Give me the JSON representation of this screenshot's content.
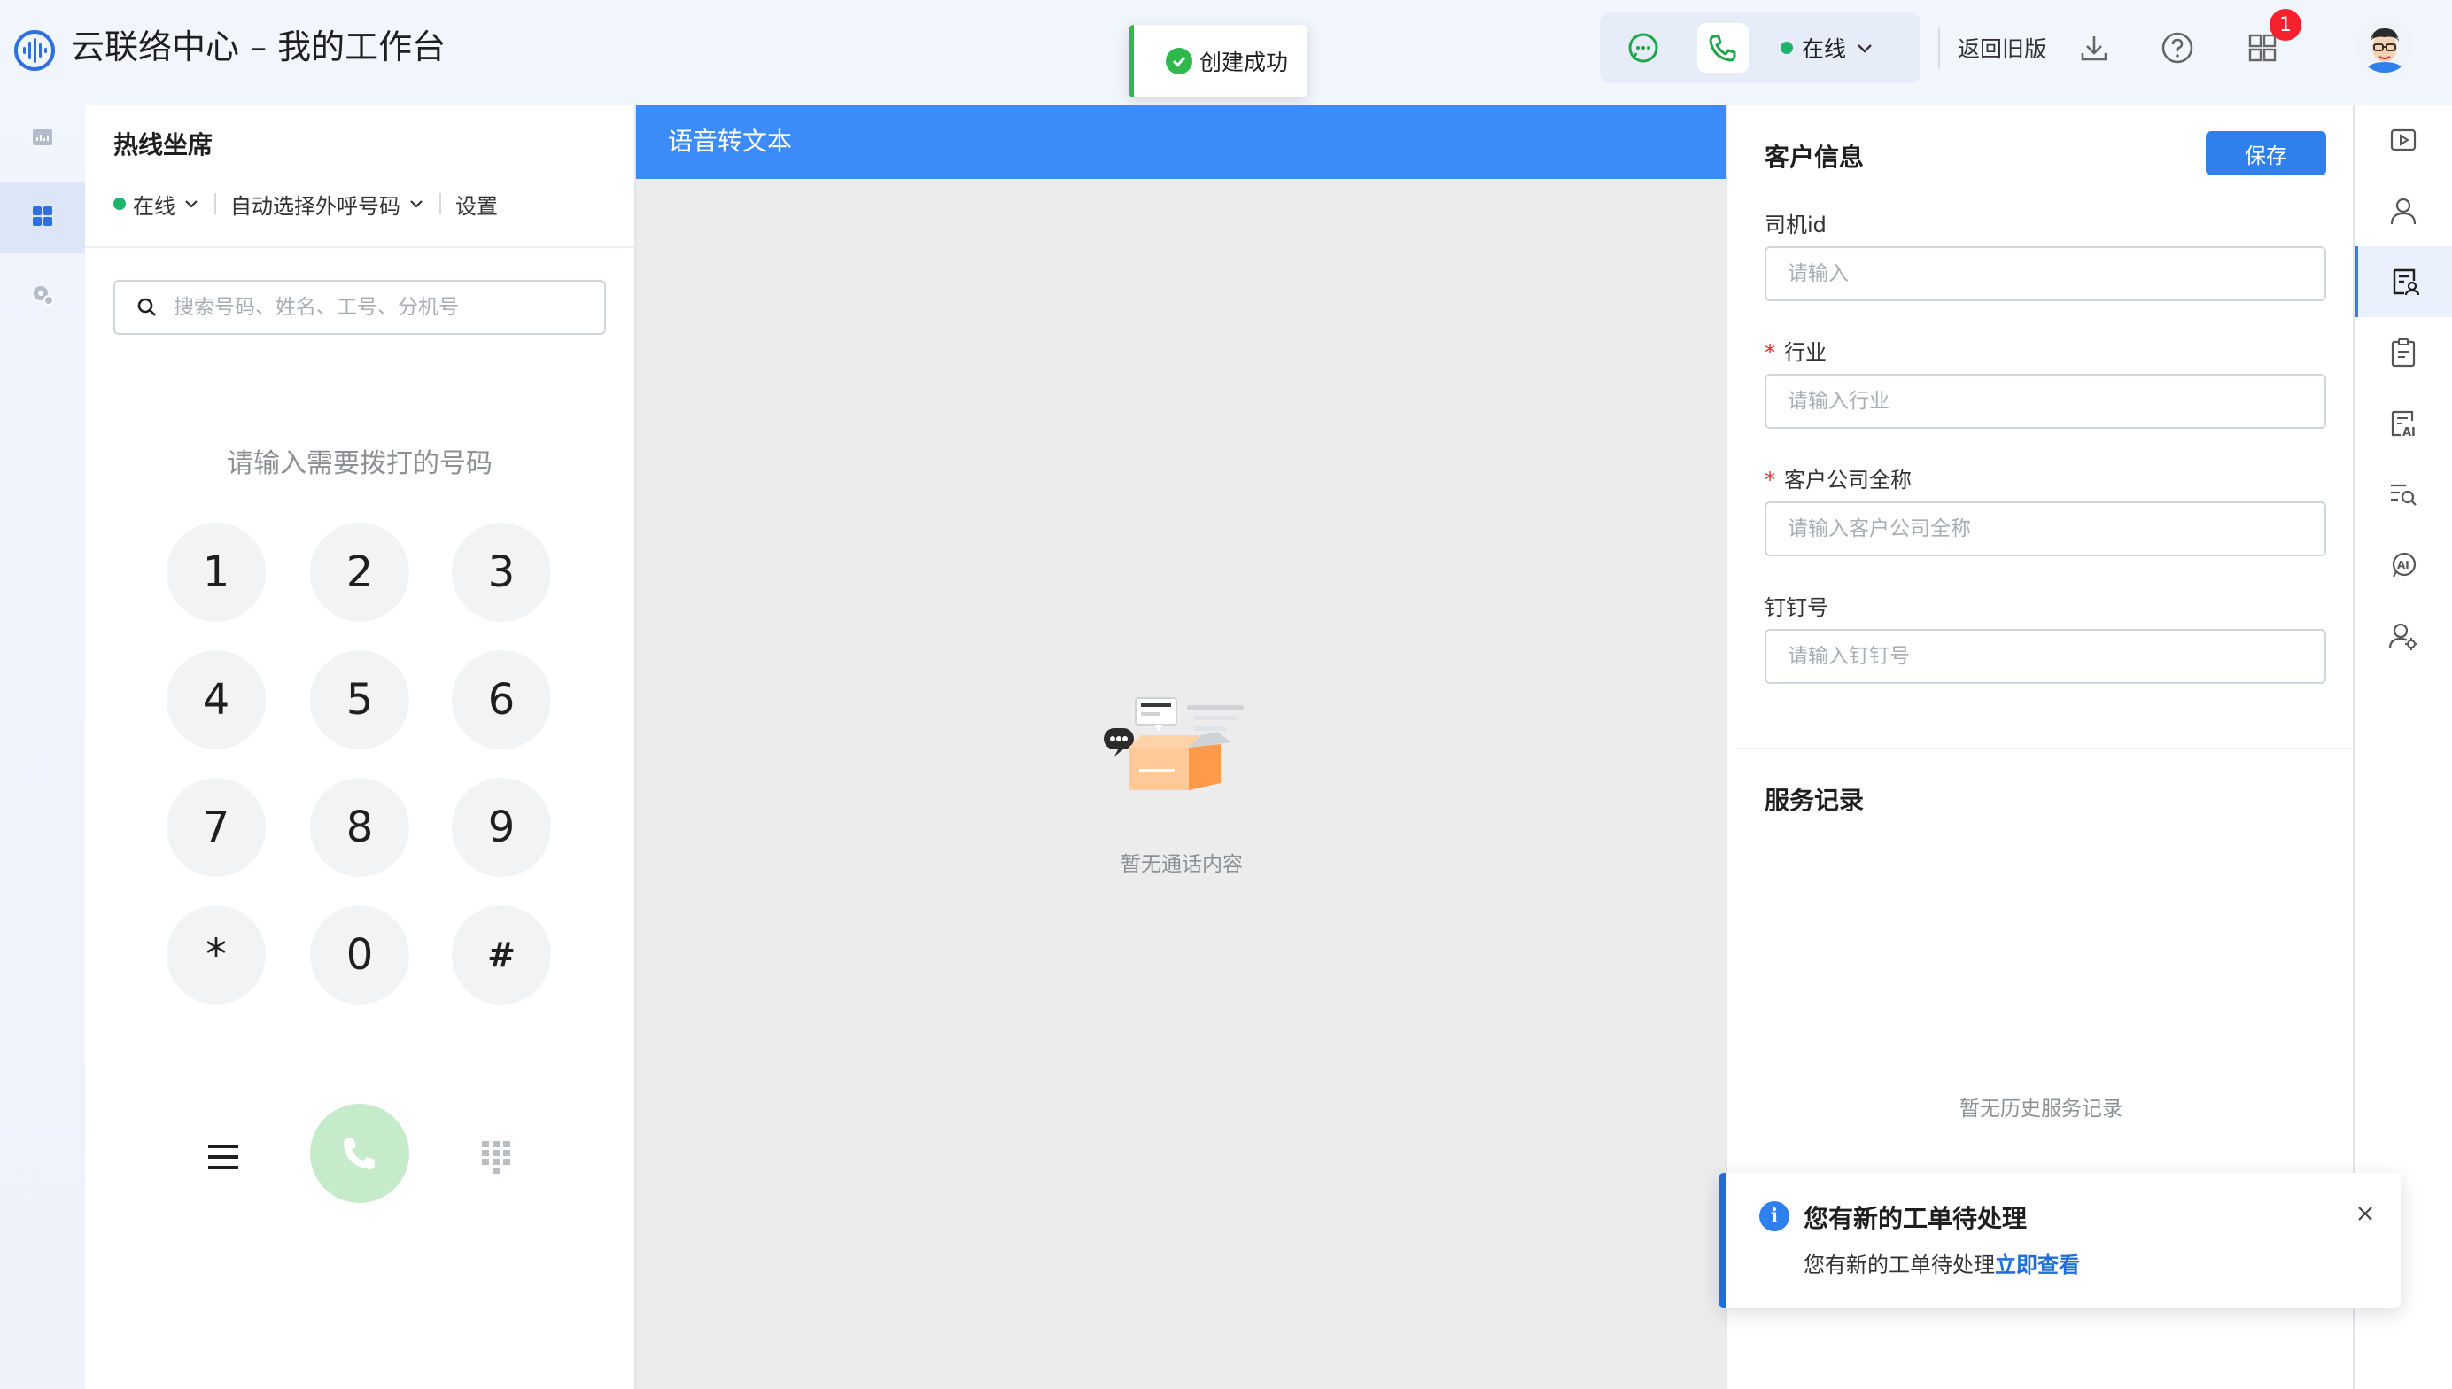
{
  "header": {
    "title": "云联络中心 – 我的工作台",
    "status_label": "在线",
    "back_old_label": "返回旧版",
    "apps_badge_count": "1",
    "icons": [
      "waveform-logo-icon",
      "chat-icon",
      "phone-icon",
      "chevron-down-icon",
      "download-icon",
      "help-icon",
      "apps-grid-icon",
      "avatar"
    ]
  },
  "toast": {
    "text": "创建成功",
    "color": "#2fb84c"
  },
  "mini_nav": {
    "items": [
      {
        "name": "dashboard-icon"
      },
      {
        "name": "workbench-icon",
        "active": true
      },
      {
        "name": "settings-icon"
      }
    ]
  },
  "dial_panel": {
    "title": "热线坐席",
    "status_label": "在线",
    "outbound_select_label": "自动选择外呼号码",
    "settings_label": "设置",
    "search_placeholder": "搜索号码、姓名、工号、分机号",
    "hint": "请输入需要拨打的号码",
    "keys": [
      "1",
      "2",
      "3",
      "4",
      "5",
      "6",
      "7",
      "8",
      "9",
      "*",
      "0",
      "#"
    ]
  },
  "transcript": {
    "title": "语音转文本",
    "empty_text": "暂无通话内容",
    "header_color": "#3b8cf8"
  },
  "customer": {
    "title": "客户信息",
    "save_label": "保存",
    "fields": [
      {
        "label": "司机id",
        "required": false,
        "placeholder": "请输入"
      },
      {
        "label": "行业",
        "required": true,
        "placeholder": "请输入行业"
      },
      {
        "label": "客户公司全称",
        "required": true,
        "placeholder": "请输入客户公司全称"
      },
      {
        "label": "钉钉号",
        "required": false,
        "placeholder": "请输入钉钉号"
      }
    ],
    "required_mark": "*",
    "service_title": "服务记录",
    "service_empty": "暂无历史服务记录"
  },
  "right_rail": {
    "items": [
      {
        "name": "video-icon"
      },
      {
        "name": "user-icon"
      },
      {
        "name": "customer-form-icon",
        "active": true
      },
      {
        "name": "clipboard-icon"
      },
      {
        "name": "ai-document-icon"
      },
      {
        "name": "search-list-icon"
      },
      {
        "name": "ai-chat-icon"
      },
      {
        "name": "user-settings-icon"
      }
    ]
  },
  "notification": {
    "title": "您有新的工单待处理",
    "body": "您有新的工单待处理",
    "link": "立即查看",
    "accent": "#1f6fd6"
  }
}
